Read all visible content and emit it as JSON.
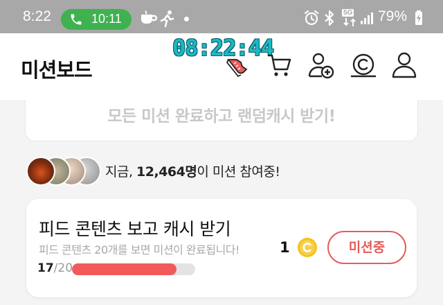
{
  "status_bar": {
    "time": "8:22",
    "call_time": "10:11",
    "network": "5G",
    "battery": "79%"
  },
  "header": {
    "title": "미션보드",
    "clock_overlay": "08:22:44",
    "icons": [
      "cart-icon",
      "add-friend-icon",
      "cash-icon",
      "profile-icon"
    ]
  },
  "banner": {
    "text": "모든 미션 완료하고 랜덤캐시 받기!"
  },
  "participants": {
    "prefix": "지금, ",
    "count": "12,464명",
    "suffix": "이 미션 참여중!"
  },
  "mission": {
    "title": "피드 콘텐츠 보고 캐시 받기",
    "description": "피드 콘텐츠 20개를 보면 미션이 완료됩니다!",
    "progress_done": "17",
    "progress_total": "/20",
    "progress_fraction": 0.85,
    "reward_amount": "1",
    "button_label": "미션중"
  },
  "colors": {
    "accent": "#e85a5a",
    "progress_fill": "#f25a5a",
    "call_pill": "#3fb24f",
    "coin": "#f5c21a",
    "clock_overlay": "#1cb8c6"
  }
}
